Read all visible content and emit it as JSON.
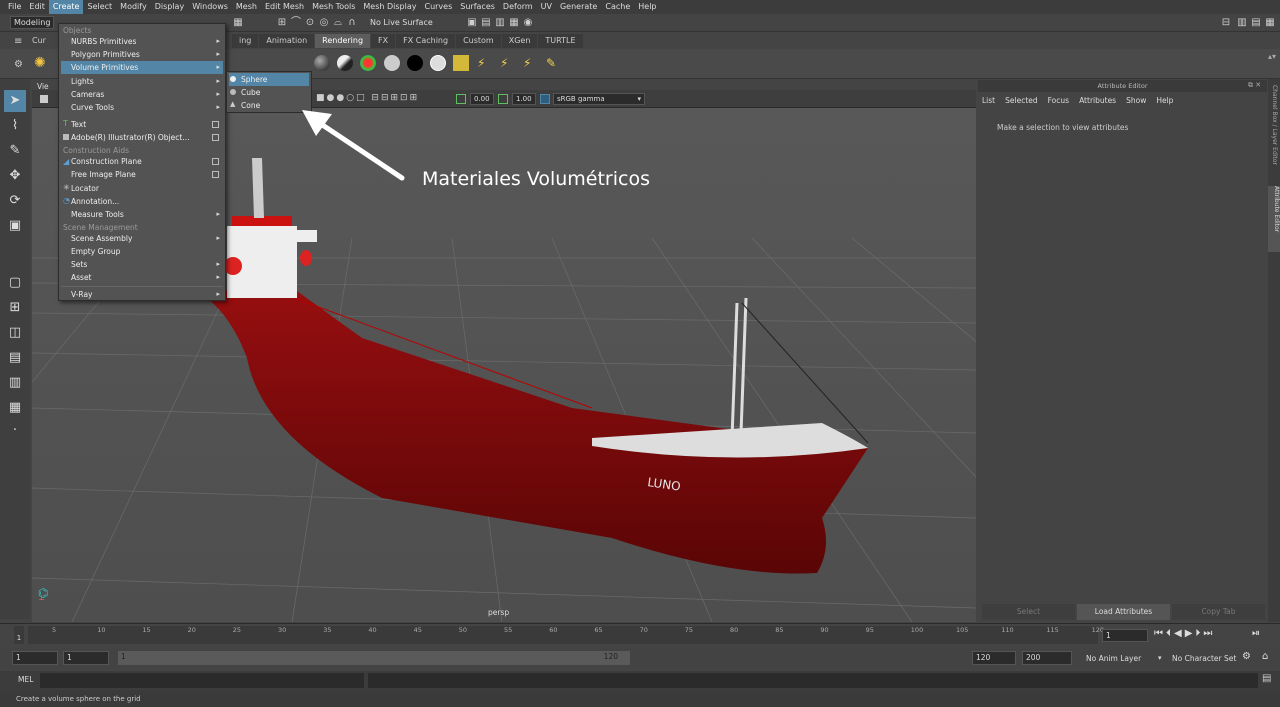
{
  "menubar": [
    "File",
    "Edit",
    "Create",
    "Select",
    "Modify",
    "Display",
    "Windows",
    "Mesh",
    "Edit Mesh",
    "Mesh Tools",
    "Mesh Display",
    "Curves",
    "Surfaces",
    "Deform",
    "UV",
    "Generate",
    "Cache",
    "Help"
  ],
  "status": {
    "mode": "Modeling",
    "live_surface": "No Live Surface"
  },
  "shelf_tabs": [
    "Cur",
    "ing",
    "Animation",
    "Rendering",
    "FX",
    "FX Caching",
    "Custom",
    "XGen",
    "TURTLE"
  ],
  "shelf_active": "Rendering",
  "viewport": {
    "menu_label": "Vie",
    "exposure": "0.00",
    "gamma": "1.00",
    "color_space": "sRGB gamma",
    "camera": "persp",
    "ship_name": "LUNO"
  },
  "create_menu": {
    "header_objects": "Objects",
    "items": [
      {
        "label": "NURBS Primitives",
        "arrow": "▸"
      },
      {
        "label": "Polygon Primitives",
        "arrow": "▸"
      },
      {
        "label": "Volume Primitives",
        "arrow": "▸"
      },
      {
        "label": "Lights",
        "arrow": "▸"
      },
      {
        "label": "Cameras",
        "arrow": "▸"
      },
      {
        "label": "Curve Tools",
        "arrow": "▸"
      }
    ],
    "items2": [
      {
        "label": "Text"
      },
      {
        "label": "Adobe(R) Illustrator(R) Object..."
      }
    ],
    "header_construction": "Construction Aids",
    "items3": [
      {
        "label": "Construction Plane"
      },
      {
        "label": "Free Image Plane"
      },
      {
        "label": "Locator"
      },
      {
        "label": "Annotation..."
      },
      {
        "label": "Measure Tools",
        "arrow": "▸"
      }
    ],
    "header_scene": "Scene Management",
    "items4": [
      {
        "label": "Scene Assembly",
        "arrow": "▸"
      },
      {
        "label": "Empty Group"
      },
      {
        "label": "Sets",
        "arrow": "▸"
      },
      {
        "label": "Asset",
        "arrow": "▸"
      }
    ],
    "vray": {
      "label": "V-Ray",
      "arrow": "▸"
    }
  },
  "submenu": [
    "Sphere",
    "Cube",
    "Cone"
  ],
  "annotation": "Materiales Volumétricos",
  "attribute_editor": {
    "title": "Attribute Editor",
    "menu": [
      "List",
      "Selected",
      "Focus",
      "Attributes",
      "Show",
      "Help"
    ],
    "message": "Make a selection to view attributes",
    "buttons": [
      "Select",
      "Load Attributes",
      "Copy Tab"
    ]
  },
  "side_tabs": [
    "Channel Box / Layer Editor",
    "Attribute Editor"
  ],
  "timeline": {
    "ticks": [
      "5",
      "10",
      "15",
      "20",
      "25",
      "30",
      "35",
      "40",
      "45",
      "50",
      "55",
      "60",
      "65",
      "70",
      "75",
      "80",
      "85",
      "90",
      "95",
      "100",
      "105",
      "110",
      "115",
      "120"
    ],
    "start_marker": "1",
    "current_frame": "1"
  },
  "range": {
    "start": "1",
    "playback_start": "1",
    "slider_start": "1",
    "slider_end": "120",
    "playback_end": "120",
    "end": "200",
    "anim_layer": "No Anim Layer",
    "char_set": "No Character Set"
  },
  "mel_label": "MEL",
  "help_text": "Create a volume sphere on the grid"
}
